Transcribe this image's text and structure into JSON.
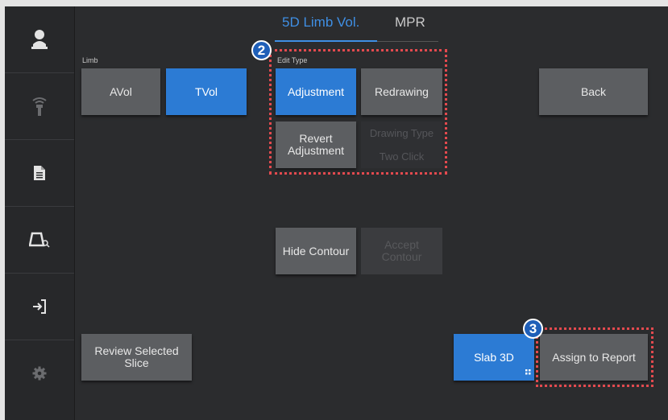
{
  "tabs": [
    {
      "label": "5D Limb Vol.",
      "active": true
    },
    {
      "label": "MPR",
      "active": false
    }
  ],
  "sidebar": {
    "items": [
      {
        "icon": "user-icon"
      },
      {
        "icon": "probe-icon"
      },
      {
        "icon": "document-icon"
      },
      {
        "icon": "image-search-icon"
      },
      {
        "icon": "exit-icon"
      },
      {
        "icon": "gear-icon"
      }
    ]
  },
  "limb": {
    "label": "Limb",
    "buttons": [
      {
        "label": "AVol",
        "selected": false
      },
      {
        "label": "TVol",
        "selected": true
      }
    ]
  },
  "edit_type": {
    "label": "Edit Type",
    "adjustment": "Adjustment",
    "redrawing": "Redrawing",
    "revert_adjustment": "Revert Adjustment",
    "drawing_type": "Drawing Type",
    "two_click": "Two Click"
  },
  "back": "Back",
  "hide_contour": "Hide Contour",
  "accept_contour": "Accept Contour",
  "review_selected_slice": "Review Selected Slice",
  "slab_3d": "Slab 3D",
  "assign_to_report": "Assign to Report",
  "callouts": [
    "2",
    "3"
  ],
  "colors": {
    "accent": "#2c7bd4",
    "highlight": "#e34a4f",
    "background": "#2b2c2e"
  }
}
